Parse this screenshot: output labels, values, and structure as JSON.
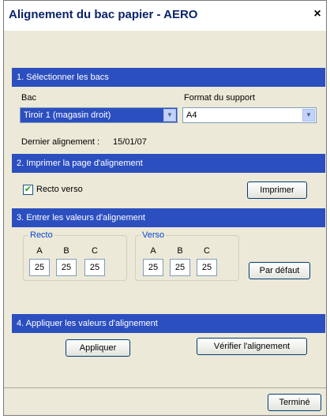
{
  "window": {
    "title": "Alignement du bac papier - AERO",
    "close_label": "×"
  },
  "section1": {
    "header": "1. Sélectionner les bacs",
    "bac_label": "Bac",
    "bac_value": "Tiroir 1 (magasin droit)",
    "format_label": "Format du support",
    "format_value": "A4",
    "last_align_label": "Dernier alignement :",
    "last_align_value": "15/01/07"
  },
  "section2": {
    "header": "2. Imprimer la page d'alignement",
    "duplex_label": "Recto verso",
    "duplex_checked": true,
    "print_button": "Imprimer"
  },
  "section3": {
    "header": "3. Entrer les valeurs d'alignement",
    "recto": {
      "legend": "Recto",
      "cols": [
        "A",
        "B",
        "C"
      ],
      "values": [
        "25",
        "25",
        "25"
      ]
    },
    "verso": {
      "legend": "Verso",
      "cols": [
        "A",
        "B",
        "C"
      ],
      "values": [
        "25",
        "25",
        "25"
      ]
    },
    "default_button": "Par défaut"
  },
  "section4": {
    "header": "4. Appliquer les valeurs d'alignement",
    "apply_button": "Appliquer",
    "verify_button": "Vérifier l'alignement"
  },
  "footer": {
    "done_button": "Terminé"
  }
}
